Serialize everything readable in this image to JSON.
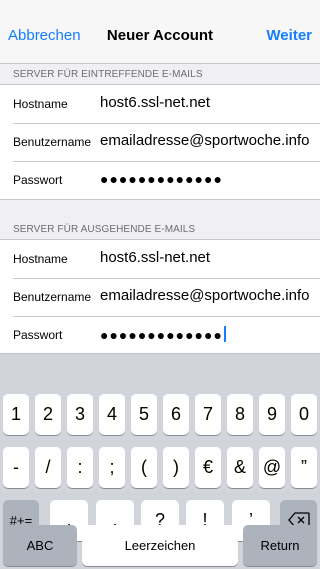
{
  "navbar": {
    "left_label": "Abbrechen",
    "title": "Neuer Account",
    "right_label": "Weiter"
  },
  "incoming": {
    "header": "SERVER FÜR EINTREFFENDE E-MAILS",
    "hostname_label": "Hostname",
    "hostname_value": "host6.ssl-net.net",
    "username_label": "Benutzername",
    "username_value": "emailadresse@sportwoche.info",
    "password_label": "Passwort",
    "password_value": "●●●●●●●●●●●●●"
  },
  "outgoing": {
    "header": "SERVER FÜR AUSGEHENDE E-MAILS",
    "hostname_label": "Hostname",
    "hostname_value": "host6.ssl-net.net",
    "username_label": "Benutzername",
    "username_value": "emailadresse@sportwoche.info",
    "password_label": "Passwort",
    "password_value": "●●●●●●●●●●●●●"
  },
  "keyboard": {
    "row1": [
      "1",
      "2",
      "3",
      "4",
      "5",
      "6",
      "7",
      "8",
      "9",
      "0"
    ],
    "row2": [
      "-",
      "/",
      ":",
      ";",
      "(",
      ")",
      "€",
      "&",
      "@",
      "”"
    ],
    "shift_label": "#+=",
    "row3": [
      ".",
      ",",
      "?",
      "!",
      "’"
    ],
    "abc_label": "ABC",
    "space_label": "Leerzeichen",
    "return_label": "Return",
    "delete_icon": "backspace-icon"
  },
  "colors": {
    "accent": "#147efb",
    "background": "#efeff4",
    "keyboard_bg": "#d1d5db",
    "dark_key": "#acb3bc"
  }
}
